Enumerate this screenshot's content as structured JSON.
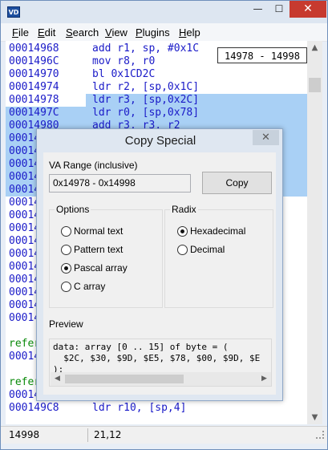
{
  "app": {
    "icon_text": "VD"
  },
  "titlebar": {
    "minimize": "—",
    "maximize": "☐",
    "close": "✕"
  },
  "menu": [
    "File",
    "Edit",
    "Search",
    "View",
    "Plugins",
    "Help"
  ],
  "range_box": "14978 - 14998",
  "code_rows": [
    {
      "addr": "00014968",
      "ins": "add r1, sp, #0x1C",
      "sel": "none"
    },
    {
      "addr": "0001496C",
      "ins": "mov r8, r0",
      "sel": "none"
    },
    {
      "addr": "00014970",
      "ins": "bl 0x1CD2C",
      "sel": "none"
    },
    {
      "addr": "00014974",
      "ins": "ldr r2, [sp,0x1C]",
      "sel": "none"
    },
    {
      "addr": "00014978",
      "ins": "ldr r3, [sp,0x2C]",
      "sel": "partial"
    },
    {
      "addr": "0001497C",
      "ins": "ldr r0, [sp,0x78]",
      "sel": "full"
    },
    {
      "addr": "00014980",
      "ins": "add r3, r3, r2",
      "sel": "full"
    },
    {
      "addr": "00014",
      "ins": "",
      "sel": "full"
    },
    {
      "addr": "00014",
      "ins": "",
      "sel": "full"
    },
    {
      "addr": "00014",
      "ins": "",
      "sel": "full"
    },
    {
      "addr": "00014",
      "ins": "",
      "sel": "full"
    },
    {
      "addr": "00014",
      "ins": "",
      "sel": "full"
    },
    {
      "addr": "00014",
      "ins": "",
      "sel": "none"
    },
    {
      "addr": "00014",
      "ins": "",
      "sel": "none"
    },
    {
      "addr": "00014",
      "ins": "",
      "sel": "none"
    },
    {
      "addr": "00014",
      "ins": "",
      "sel": "none"
    },
    {
      "addr": "00014",
      "ins": "",
      "sel": "none"
    },
    {
      "addr": "00014",
      "ins": "",
      "sel": "none"
    },
    {
      "addr": "00014",
      "ins": "",
      "sel": "none"
    },
    {
      "addr": "00014",
      "ins": "",
      "sel": "none"
    },
    {
      "addr": "00014",
      "ins": "",
      "sel": "none"
    },
    {
      "addr": "00014",
      "ins": "",
      "sel": "none"
    },
    {
      "addr": "",
      "ins": "",
      "sel": "none"
    },
    {
      "addr": "refer",
      "ins": "",
      "sel": "none",
      "green": true
    },
    {
      "addr": "00014",
      "ins": "",
      "sel": "none"
    },
    {
      "addr": "",
      "ins": "",
      "sel": "none"
    },
    {
      "addr": "refer",
      "ins": "",
      "sel": "none",
      "green": true
    },
    {
      "addr": "00014",
      "ins": "",
      "sel": "none"
    },
    {
      "addr": "000149C8",
      "ins": "ldr r10, [sp,4]",
      "sel": "none"
    }
  ],
  "status": {
    "left": "14998",
    "right": "21,12"
  },
  "dialog": {
    "title": "Copy Special",
    "close": "✕",
    "va_range_label": "VA Range (inclusive)",
    "va_range_value": "0x14978 - 0x14998",
    "copy_button": "Copy",
    "options_title": "Options",
    "options": [
      {
        "label": "Normal text",
        "checked": false
      },
      {
        "label": "Pattern text",
        "checked": false
      },
      {
        "label": "Pascal array",
        "checked": true
      },
      {
        "label": "C array",
        "checked": false
      }
    ],
    "radix_title": "Radix",
    "radix": [
      {
        "label": "Hexadecimal",
        "checked": true
      },
      {
        "label": "Decimal",
        "checked": false
      }
    ],
    "preview_label": "Preview",
    "preview_lines": [
      "data: array [0 .. 15] of byte = (",
      "  $2C, $30, $9D, $E5, $78, $00, $9D, $E",
      ");"
    ]
  },
  "colors": {
    "selection": "#a9d0f5",
    "code_blue": "#1a1ac8",
    "code_green": "#0a8a0a"
  }
}
